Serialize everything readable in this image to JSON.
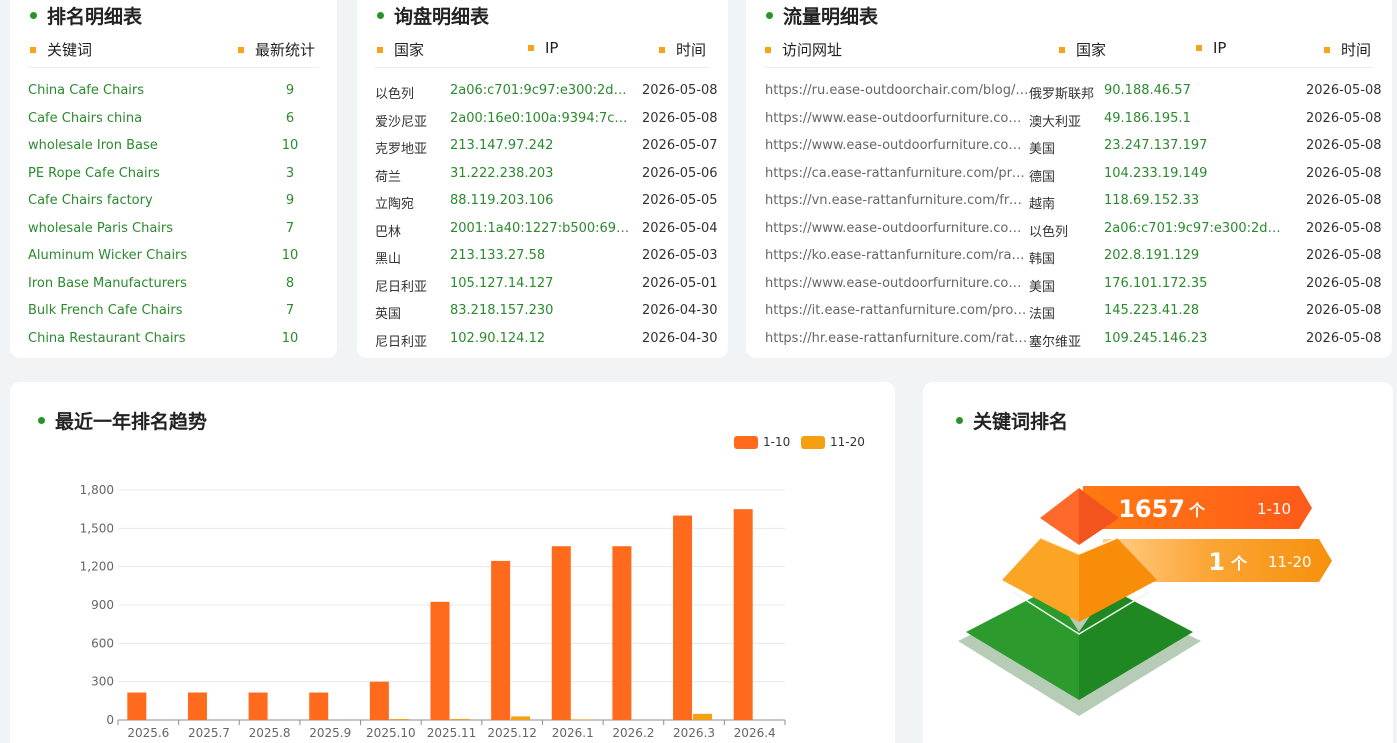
{
  "ranking": {
    "title": "排名明细表",
    "headers": [
      "关键词",
      "最新统计"
    ],
    "rows": [
      {
        "keyword": "China Cafe Chairs",
        "count": "9"
      },
      {
        "keyword": "Cafe Chairs china",
        "count": "6"
      },
      {
        "keyword": "wholesale Iron Base",
        "count": "10"
      },
      {
        "keyword": "PE Rope Cafe Chairs",
        "count": "3"
      },
      {
        "keyword": "Cafe Chairs factory",
        "count": "9"
      },
      {
        "keyword": "wholesale Paris Chairs",
        "count": "7"
      },
      {
        "keyword": "Aluminum Wicker Chairs",
        "count": "10"
      },
      {
        "keyword": "Iron Base Manufacturers",
        "count": "8"
      },
      {
        "keyword": "Bulk French Cafe Chairs",
        "count": "7"
      },
      {
        "keyword": "China Restaurant Chairs",
        "count": "10"
      }
    ]
  },
  "inquiry": {
    "title": "询盘明细表",
    "headers": [
      "国家",
      "IP",
      "时间"
    ],
    "rows": [
      {
        "country": "以色列",
        "ip": "2a06:c701:9c97:e300:2d89:...",
        "time": "2026-05-08"
      },
      {
        "country": "爱沙尼亚",
        "ip": "2a00:16e0:100a:9394:7ce6:...",
        "time": "2026-05-08"
      },
      {
        "country": "克罗地亚",
        "ip": "213.147.97.242",
        "time": "2026-05-07"
      },
      {
        "country": "荷兰",
        "ip": "31.222.238.203",
        "time": "2026-05-06"
      },
      {
        "country": "立陶宛",
        "ip": "88.119.203.106",
        "time": "2026-05-05"
      },
      {
        "country": "巴林",
        "ip": "2001:1a40:1227:b500:69a2:...",
        "time": "2026-05-04"
      },
      {
        "country": "黑山",
        "ip": "213.133.27.58",
        "time": "2026-05-03"
      },
      {
        "country": "尼日利亚",
        "ip": "105.127.14.127",
        "time": "2026-05-01"
      },
      {
        "country": "英国",
        "ip": "83.218.157.230",
        "time": "2026-04-30"
      },
      {
        "country": "尼日利亚",
        "ip": "102.90.124.12",
        "time": "2026-04-30"
      }
    ]
  },
  "traffic": {
    "title": "流量明细表",
    "headers": [
      "访问网址",
      "国家",
      "IP",
      "时间"
    ],
    "rows": [
      {
        "url": "https://ru.ease-outdoorchair.com/blog/h...",
        "country": "俄罗斯联邦",
        "ip": "90.188.46.57",
        "time": "2026-05-08"
      },
      {
        "url": "https://www.ease-outdoorfurniture.com/...",
        "country": "澳大利亚",
        "ip": "49.186.195.1",
        "time": "2026-05-08"
      },
      {
        "url": "https://www.ease-outdoorfurniture.com/...",
        "country": "美国",
        "ip": "23.247.137.197",
        "time": "2026-05-08"
      },
      {
        "url": "https://ca.ease-rattanfurniture.com/prod...",
        "country": "德国",
        "ip": "104.233.19.149",
        "time": "2026-05-08"
      },
      {
        "url": "https://vn.ease-rattanfurniture.com/fren...",
        "country": "越南",
        "ip": "118.69.152.33",
        "time": "2026-05-08"
      },
      {
        "url": "https://www.ease-outdoorfurniture.com/...",
        "country": "以色列",
        "ip": "2a06:c701:9c97:e300:2d89:d...",
        "time": "2026-05-08"
      },
      {
        "url": "https://ko.ease-rattanfurniture.com/ratta...",
        "country": "韩国",
        "ip": "202.8.191.129",
        "time": "2026-05-08"
      },
      {
        "url": "https://www.ease-outdoorfurniture.com/...",
        "country": "美国",
        "ip": "176.101.172.35",
        "time": "2026-05-08"
      },
      {
        "url": "https://it.ease-rattanfurniture.com/prod...",
        "country": "法国",
        "ip": "145.223.41.28",
        "time": "2026-05-08"
      },
      {
        "url": "https://hr.ease-rattanfurniture.com/ratta...",
        "country": "塞尔维亚",
        "ip": "109.245.146.23",
        "time": "2026-05-08"
      }
    ]
  },
  "trend": {
    "title": "最近一年排名趋势"
  },
  "chart_data": {
    "type": "bar",
    "title": "",
    "xlabel": "",
    "ylabel": "",
    "categories": [
      "2025.6",
      "2025.7",
      "2025.8",
      "2025.9",
      "2025.10",
      "2025.11",
      "2025.12",
      "2026.1",
      "2026.2",
      "2026.3",
      "2026.4"
    ],
    "series": [
      {
        "name": "1-10",
        "color": "#ff6a1c",
        "values": [
          215,
          215,
          215,
          215,
          300,
          925,
          1245,
          1360,
          1360,
          1600,
          1650
        ]
      },
      {
        "name": "11-20",
        "color": "#f5a011",
        "values": [
          0,
          0,
          0,
          0,
          8,
          8,
          28,
          5,
          0,
          48,
          1
        ]
      }
    ],
    "ylim": [
      0,
      1800
    ],
    "yticks": [
      "0",
      "300",
      "600",
      "900",
      "1,200",
      "1,500",
      "1,800"
    ],
    "grid": true,
    "legend": "top-right"
  },
  "keyword_rank": {
    "title": "关键词排名",
    "unit": "个",
    "levels": [
      {
        "count": "1657",
        "label": "1-10",
        "color": "#ff6a1c"
      },
      {
        "count": "1",
        "label": "11-20",
        "color": "#f7980f"
      }
    ]
  },
  "colors": {
    "accent_green": "#279428",
    "bullet_orange": "#f7a21b",
    "bar_orange": "#ff6a1c",
    "bar_amber": "#f5a011"
  }
}
